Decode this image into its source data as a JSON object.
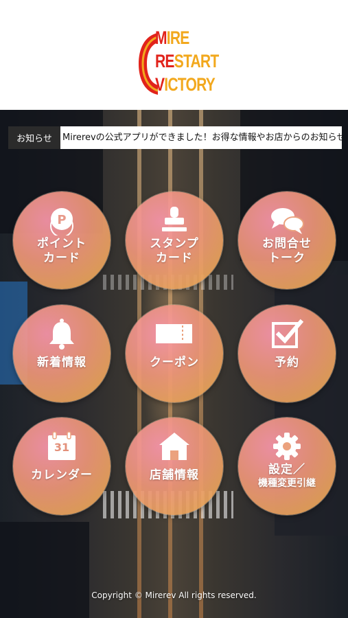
{
  "logo": {
    "lines": [
      {
        "highlight": "M",
        "rest": "IRE"
      },
      {
        "highlight": "RE",
        "rest": "START"
      },
      {
        "highlight": "V",
        "rest": "ICTORY"
      }
    ]
  },
  "notice": {
    "label": "お知らせ",
    "text": "Mirerevの公式アプリができました！お得な情報やお店からのお知らせをお届けします"
  },
  "menu": [
    {
      "line1": "ポイント",
      "line2": "カード",
      "icon": "points-coin-icon"
    },
    {
      "line1": "スタンプ",
      "line2": "カード",
      "icon": "stamp-icon"
    },
    {
      "line1": "お問合せ",
      "line2": "トーク",
      "icon": "chat-bubbles-icon"
    },
    {
      "line1": "新着情報",
      "line2": "",
      "icon": "bell-icon"
    },
    {
      "line1": "クーポン",
      "line2": "",
      "icon": "coupon-ticket-icon"
    },
    {
      "line1": "予約",
      "line2": "",
      "icon": "checkbox-icon"
    },
    {
      "line1": "カレンダー",
      "line2": "",
      "icon": "calendar-icon",
      "calendar_day": "31"
    },
    {
      "line1": "店舗情報",
      "line2": "",
      "icon": "store-house-icon"
    },
    {
      "line1": "設定／",
      "line2": "機種変更引継",
      "icon": "gear-icon"
    }
  ],
  "colors": {
    "logo_red": "#e1231b",
    "logo_orange": "#f2a81d",
    "notice_label_bg": "#2b2b2b"
  },
  "footer": {
    "copyright": "Copyright © Mirerev All rights reserved."
  }
}
